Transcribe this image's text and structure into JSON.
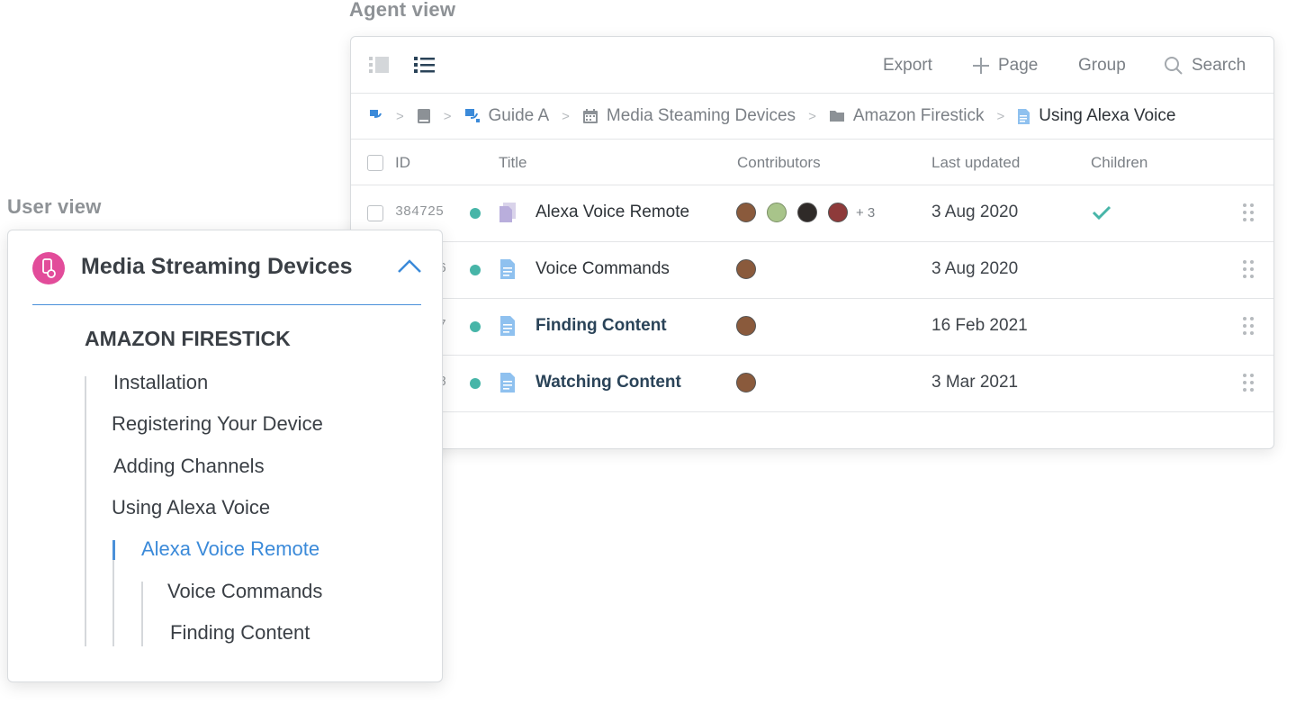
{
  "captions": {
    "agent": "Agent view",
    "user": "User view"
  },
  "agent_view": {
    "toolbar": {
      "export": "Export",
      "page": "Page",
      "group": "Group",
      "search": "Search"
    },
    "breadcrumb": [
      "Guide A",
      "Media Steaming Devices",
      "Amazon Firestick",
      "Using Alexa Voice"
    ],
    "columns": {
      "id": "ID",
      "title": "Title",
      "contributors": "Contributors",
      "last_updated": "Last updated",
      "children": "Children"
    },
    "rows": [
      {
        "id": "384725",
        "title": "Alexa Voice Remote",
        "contributors_more": "+ 3",
        "last_updated": "3 Aug 2020",
        "has_children": true
      },
      {
        "id": "6",
        "title": "Voice Commands",
        "last_updated": "3 Aug 2020",
        "has_children": false
      },
      {
        "id": "7",
        "title": "Finding Content",
        "last_updated": "16 Feb 2021",
        "has_children": false
      },
      {
        "id": "8",
        "title": "Watching Content",
        "last_updated": "3 Mar 2021",
        "has_children": false
      }
    ],
    "status_color": "#47b5a8"
  },
  "user_view": {
    "title": "Media Streaming Devices",
    "section": "AMAZON FIRESTICK",
    "items": [
      "Installation",
      "Registering Your Device",
      "Adding Channels",
      "Using Alexa Voice",
      "Alexa Voice Remote",
      "Voice Commands",
      "Finding Content"
    ],
    "active_item": "Alexa Voice Remote",
    "accent_color": "#3b8ad9",
    "icon_color": "#e24c9a"
  }
}
